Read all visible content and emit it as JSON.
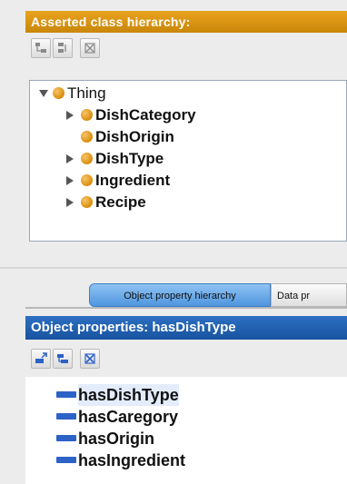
{
  "class_panel": {
    "title": "Asserted class hierarchy:",
    "toolbar": [
      "add-subclass-icon",
      "add-sibling-class-icon",
      "delete-class-icon"
    ],
    "tree": {
      "root": "Thing",
      "children": [
        "DishCategory",
        "DishOrigin",
        "DishType",
        "Ingredient",
        "Recipe"
      ]
    }
  },
  "property_panel": {
    "tabs": [
      {
        "label": "Object property hierarchy",
        "selected": true
      },
      {
        "label": "Data pr",
        "selected": false
      }
    ],
    "title": "Object properties: hasDishType",
    "toolbar": [
      "add-subproperty-icon",
      "add-sibling-property-icon",
      "delete-property-icon"
    ],
    "items": [
      "hasDishType",
      "hasCaregory",
      "hasOrigin",
      "hasIngredient"
    ],
    "selected_item": "hasDishType"
  },
  "colors": {
    "class_header": "#d9940f",
    "property_header": "#2160b0",
    "class_dot": "#e0960c",
    "property_bar": "#2d62c7"
  }
}
